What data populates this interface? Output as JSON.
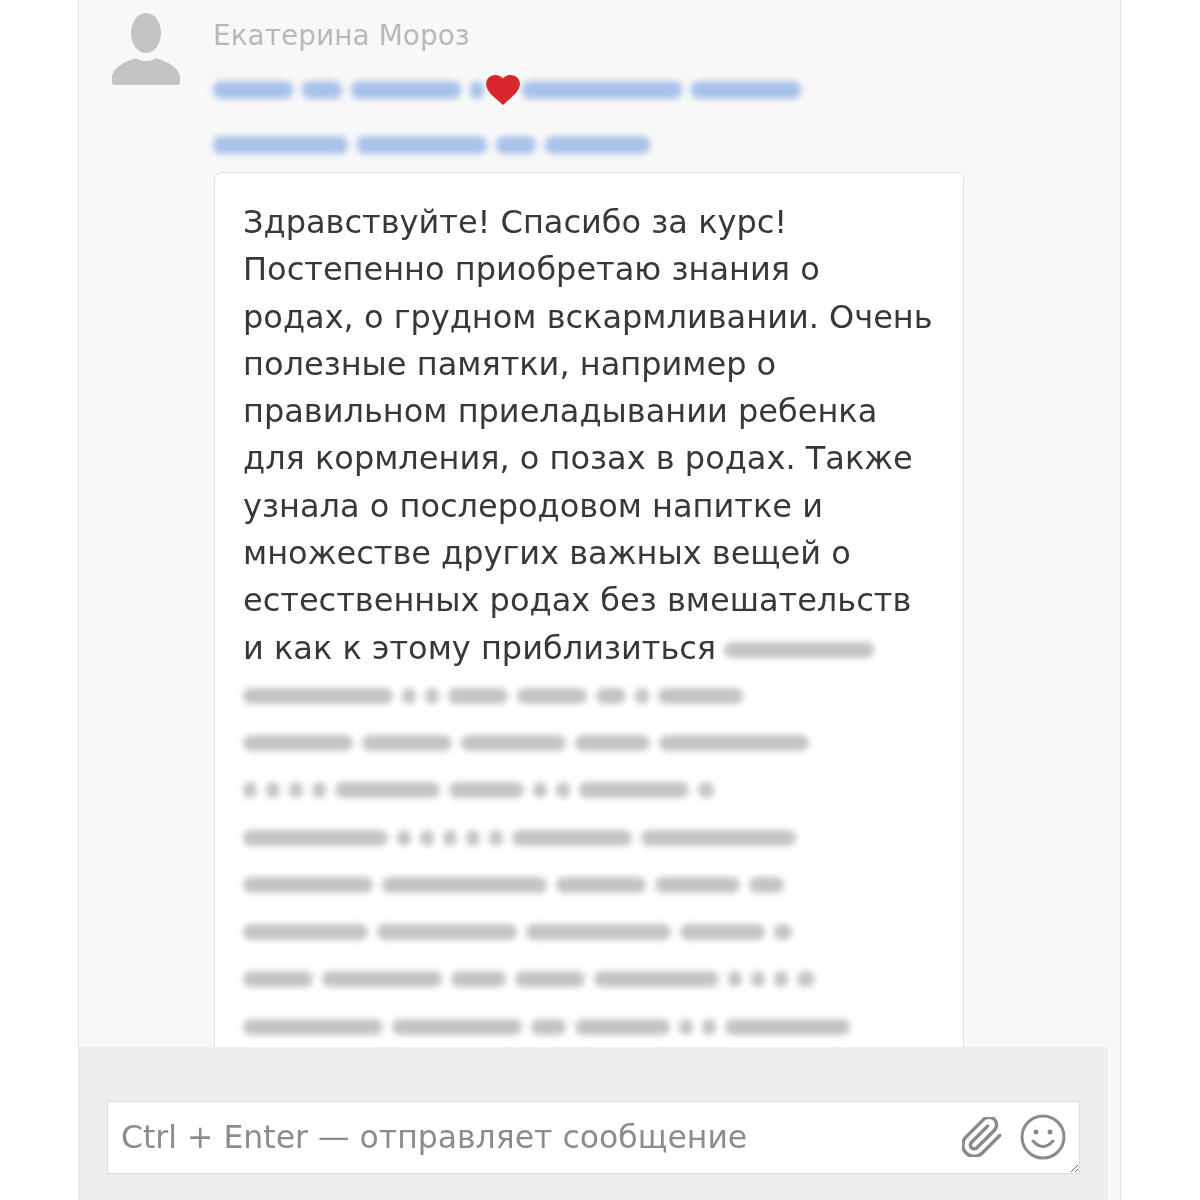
{
  "sender": {
    "name": "Екатерина Мороз"
  },
  "message": {
    "text": "Здравствуйте! Спасибо за курс! Постепенно приобретаю знания о родах, о грудном вскармливании. Очень полезные памятки, например о правильном приеладывании ребенка для кормления, о позах в родах. Также узнала о послеродовом напитке и множестве других важных вещей о естественных родах без вмешательств и как к этому приблизиться"
  },
  "composer": {
    "placeholder": "Ctrl + Enter — отправляет сообщение"
  }
}
